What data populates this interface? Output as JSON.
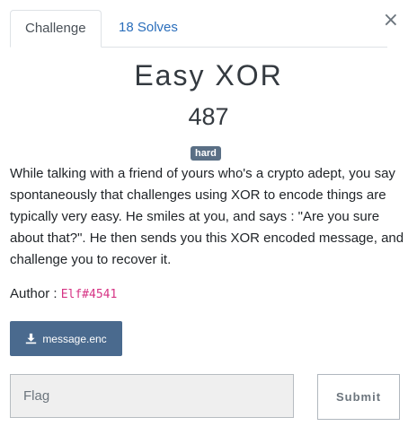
{
  "tabs": [
    {
      "label": "Challenge",
      "active": true
    },
    {
      "label": "18 Solves",
      "active": false
    }
  ],
  "close_glyph": "×",
  "challenge": {
    "title": "Easy XOR",
    "value": "487",
    "difficulty": "hard",
    "description": "While talking with a friend of yours who's a crypto adept, you say spontaneously that challenges using XOR to encode things are typically very easy. He smiles at you, and says : \"Are you sure about that?\". He then sends you this XOR encoded message, and challenge you to recover it.",
    "author_label": "Author :",
    "author": "Elf#4541"
  },
  "file": {
    "label": "message.enc",
    "icon": "download-icon"
  },
  "flag": {
    "placeholder": "Flag",
    "value": ""
  },
  "submit_label": "Submit",
  "colors": {
    "badge": "#5a6f85",
    "file_button": "#4a6a8e",
    "link": "#2a6ebb",
    "author_code": "#d63384"
  }
}
